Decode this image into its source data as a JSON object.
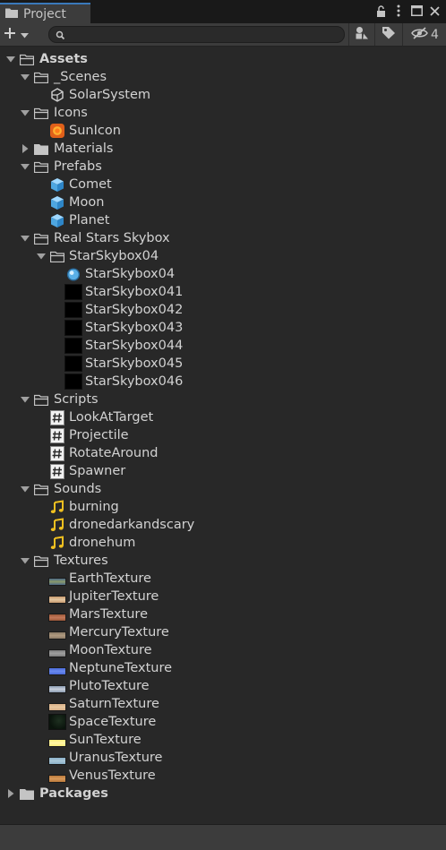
{
  "tab": {
    "title": "Project"
  },
  "toolbar": {
    "search_placeholder": "",
    "hidden_count": "4"
  },
  "tree": [
    {
      "label": "Assets",
      "depth": 0,
      "type": "folder",
      "expanded": true,
      "bold": true
    },
    {
      "label": "_Scenes",
      "depth": 1,
      "type": "folder",
      "expanded": true
    },
    {
      "label": "SolarSystem",
      "depth": 2,
      "type": "scene"
    },
    {
      "label": "Icons",
      "depth": 1,
      "type": "folder",
      "expanded": true
    },
    {
      "label": "SunIcon",
      "depth": 2,
      "type": "sunicon"
    },
    {
      "label": "Materials",
      "depth": 1,
      "type": "folder",
      "expanded": false
    },
    {
      "label": "Prefabs",
      "depth": 1,
      "type": "folder",
      "expanded": true
    },
    {
      "label": "Comet",
      "depth": 2,
      "type": "prefab"
    },
    {
      "label": "Moon",
      "depth": 2,
      "type": "prefab"
    },
    {
      "label": "Planet",
      "depth": 2,
      "type": "prefab"
    },
    {
      "label": "Real Stars Skybox",
      "depth": 1,
      "type": "folder",
      "expanded": true
    },
    {
      "label": "StarSkybox04",
      "depth": 2,
      "type": "folder",
      "expanded": true
    },
    {
      "label": "StarSkybox04",
      "depth": 3,
      "type": "material"
    },
    {
      "label": "StarSkybox041",
      "depth": 3,
      "type": "texture",
      "color": "#000000"
    },
    {
      "label": "StarSkybox042",
      "depth": 3,
      "type": "texture",
      "color": "#000000"
    },
    {
      "label": "StarSkybox043",
      "depth": 3,
      "type": "texture",
      "color": "#000000"
    },
    {
      "label": "StarSkybox044",
      "depth": 3,
      "type": "texture",
      "color": "#000000"
    },
    {
      "label": "StarSkybox045",
      "depth": 3,
      "type": "texture",
      "color": "#000000"
    },
    {
      "label": "StarSkybox046",
      "depth": 3,
      "type": "texture",
      "color": "#000000"
    },
    {
      "label": "Scripts",
      "depth": 1,
      "type": "folder",
      "expanded": true
    },
    {
      "label": "LookAtTarget",
      "depth": 2,
      "type": "script"
    },
    {
      "label": "Projectile",
      "depth": 2,
      "type": "script"
    },
    {
      "label": "RotateAround",
      "depth": 2,
      "type": "script"
    },
    {
      "label": "Spawner",
      "depth": 2,
      "type": "script"
    },
    {
      "label": "Sounds",
      "depth": 1,
      "type": "folder",
      "expanded": true
    },
    {
      "label": "burning",
      "depth": 2,
      "type": "audio"
    },
    {
      "label": "dronedarkandscary",
      "depth": 2,
      "type": "audio"
    },
    {
      "label": "dronehum",
      "depth": 2,
      "type": "audio"
    },
    {
      "label": "Textures",
      "depth": 1,
      "type": "folder",
      "expanded": true
    },
    {
      "label": "EarthTexture",
      "depth": 2,
      "type": "swatch",
      "color": "#4d6a88",
      "color2": "#8a9a6a"
    },
    {
      "label": "JupiterTexture",
      "depth": 2,
      "type": "swatch",
      "color": "#c89a6e",
      "color2": "#e4c7a1"
    },
    {
      "label": "MarsTexture",
      "depth": 2,
      "type": "swatch",
      "color": "#9a5838",
      "color2": "#c4785a"
    },
    {
      "label": "MercuryTexture",
      "depth": 2,
      "type": "swatch",
      "color": "#8a7a66",
      "color2": "#b09a80"
    },
    {
      "label": "MoonTexture",
      "depth": 2,
      "type": "swatch",
      "color": "#7c7c7c",
      "color2": "#a0a0a0"
    },
    {
      "label": "NeptuneTexture",
      "depth": 2,
      "type": "swatch",
      "color": "#4a6ad8",
      "color2": "#6a8af0"
    },
    {
      "label": "PlutoTexture",
      "depth": 2,
      "type": "swatch",
      "color": "#8a9ab0",
      "color2": "#c8d0dc"
    },
    {
      "label": "SaturnTexture",
      "depth": 2,
      "type": "swatch",
      "color": "#d8b088",
      "color2": "#e8c8a0"
    },
    {
      "label": "SpaceTexture",
      "depth": 2,
      "type": "space",
      "color": "#0a140c",
      "color2": "#1e3020"
    },
    {
      "label": "SunTexture",
      "depth": 2,
      "type": "swatch",
      "color": "#f8ec78",
      "color2": "#fff6a8"
    },
    {
      "label": "UranusTexture",
      "depth": 2,
      "type": "swatch",
      "color": "#8ab0c8",
      "color2": "#aac8d8"
    },
    {
      "label": "VenusTexture",
      "depth": 2,
      "type": "swatch",
      "color": "#b8783a",
      "color2": "#d89a5a"
    },
    {
      "label": "Packages",
      "depth": 0,
      "type": "folder",
      "expanded": false,
      "bold": true
    }
  ]
}
